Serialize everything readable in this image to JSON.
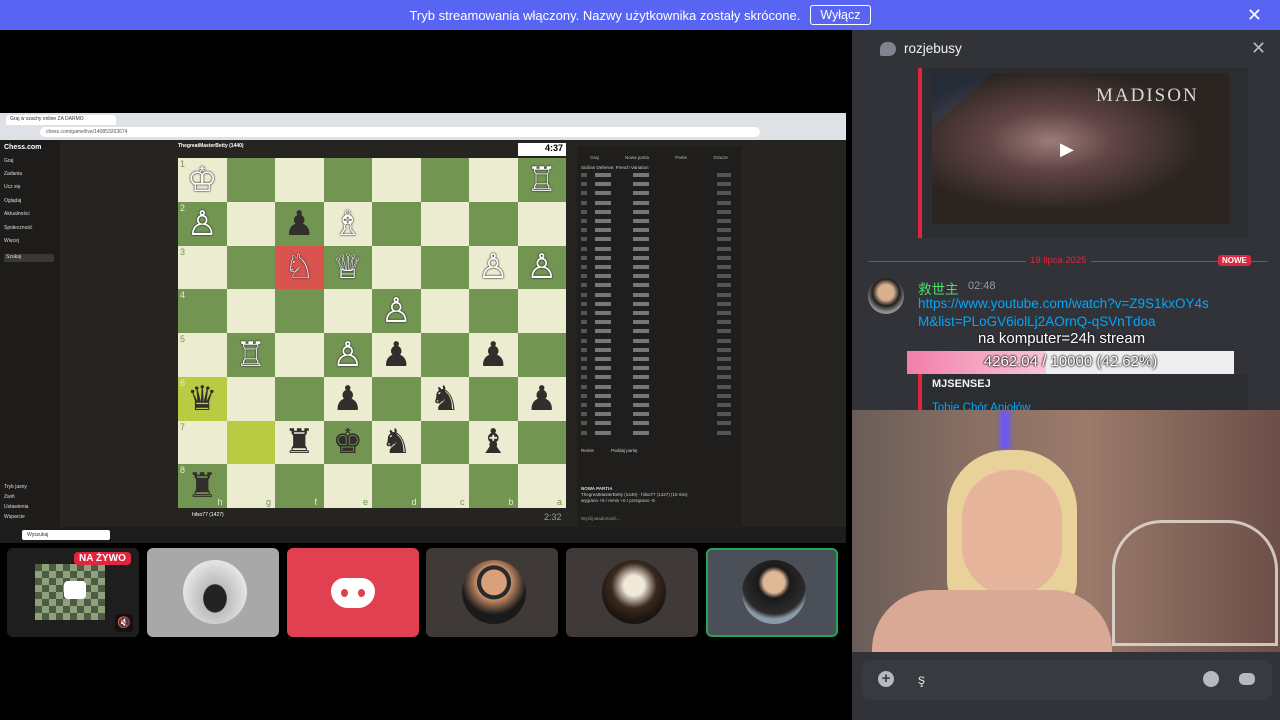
{
  "banner": {
    "text": "Tryb streamowania włączony. Nazwy użytkownika zostały skrócone.",
    "button_label": "Wyłącz",
    "close_icon": "close-icon"
  },
  "shared_screen": {
    "browser_tab": "Graj w szachy online ZA DARMO",
    "url": "chess.com/game/live/140853203674",
    "site_name": "Chess.com",
    "sidebar_items": [
      "Graj",
      "Zadania",
      "Ucz się",
      "Oglądaj",
      "Aktualności",
      "Społeczność",
      "Więcej"
    ],
    "search_placeholder": "Szukaj",
    "sidebar_bottom": [
      "Tryb jasny",
      "Zwiń",
      "Ustawienia",
      "Wsparcie"
    ],
    "top_player": "ThegreatMasterBetty (1440)",
    "bottom_player": "hilso77 (1427)",
    "top_clock": "4:37",
    "bottom_clock": "2:32",
    "opening": "Sicilian Defense: French Variation",
    "panel_tabs": [
      "Graj",
      "Nowa partia",
      "Partie",
      "Gracze"
    ],
    "panel_actions": [
      "Remis",
      "Poddaj partię"
    ],
    "chat_placeholder": "Wyślij wiadomość...",
    "chat_lines": [
      "NOWA PARTIA",
      "ThegreatMasterBetty (1440) - hilso77 (1427) (10 min)",
      "wygrano +0 / remis +0 / przegrano -8"
    ],
    "taskbar_search": "Wyszukaj",
    "board_files": [
      "h",
      "g",
      "f",
      "e",
      "d",
      "c",
      "b",
      "a"
    ],
    "board_ranks": [
      "1",
      "2",
      "3",
      "4",
      "5",
      "6",
      "7",
      "8"
    ]
  },
  "participants": [
    {
      "name": "stream",
      "live_badge": "NA ŻYWO",
      "icon": "muted-speaker-icon"
    },
    {
      "name": "car-avatar"
    },
    {
      "name": "discord-avatar",
      "color": "#e0404f"
    },
    {
      "name": "sunglasses-avatar"
    },
    {
      "name": "dog-avatar"
    },
    {
      "name": "leader-avatar",
      "speaking": true
    }
  ],
  "channel": {
    "name": "rozjebusy",
    "close_icon": "close-icon"
  },
  "embed": {
    "brand": "MADISON",
    "play_icon": "play-icon"
  },
  "divider": {
    "date": "19 lipca 2025",
    "badge": "NOWE"
  },
  "message": {
    "author": "救世主",
    "time": "02:48",
    "link": "https://www.youtube.com/watch?v=Z9S1kxOY4sM&list=PLoGV6iolLj2AOrnQ-qSVnTdoa"
  },
  "stream_overlay": {
    "title": "na komputer=24h stream",
    "progress_text": "4262.04 / 10000 (42.62%)",
    "progress_fraction": 0.4262
  },
  "embed2": {
    "title": "MJSENSEJ",
    "link": "Tobie Chór Aniołów"
  },
  "input": {
    "value": "ş"
  },
  "colors": {
    "banner": "#5865f2",
    "accent_red": "#e0263f",
    "username_green": "#4ede6d",
    "link_blue": "#00a8fc",
    "board_light": "#ebecd0",
    "board_dark": "#739552"
  }
}
